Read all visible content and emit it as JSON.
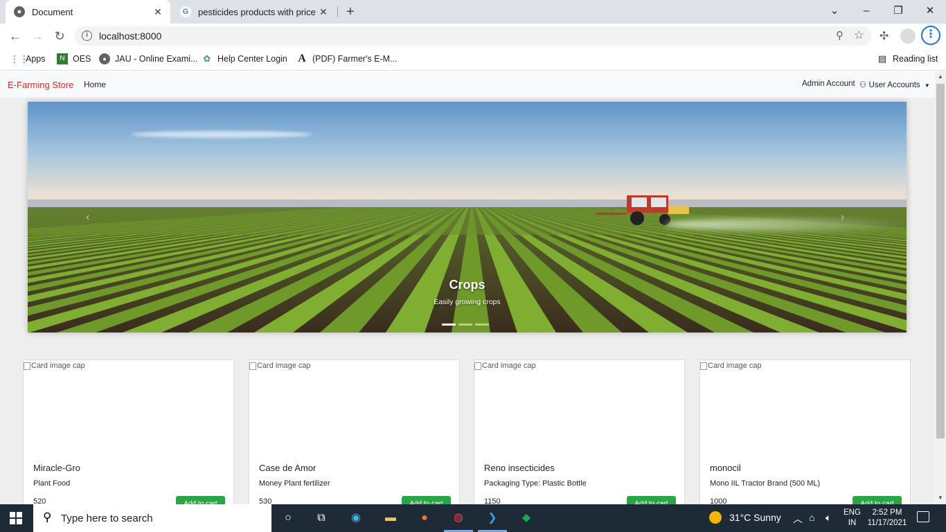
{
  "browser": {
    "tabs": [
      {
        "title": "Document",
        "favicon": "globe-icon",
        "active": true
      },
      {
        "title": "pesticides products with price - G",
        "favicon": "google-icon",
        "active": false
      }
    ],
    "url": "localhost:8000",
    "bookmarks": [
      {
        "label": "Apps",
        "icon": "apps-grid-icon"
      },
      {
        "label": "OES",
        "icon": "oes-icon"
      },
      {
        "label": "JAU - Online Exami...",
        "icon": "globe-icon"
      },
      {
        "label": "Help Center Login",
        "icon": "help-center-icon"
      },
      {
        "label": "(PDF) Farmer's E-M...",
        "icon": "academia-icon"
      }
    ],
    "reading_list": "Reading list"
  },
  "site": {
    "brand": "E-Farming Store",
    "home": "Home",
    "admin": "Admin Account",
    "users": "User Accounts"
  },
  "carousel": {
    "title": "Crops",
    "text": "Easily growing crops",
    "slides": 3,
    "active_slide": 1
  },
  "cards": [
    {
      "img_alt": "Card image cap",
      "name": "Miracle-Gro",
      "desc": "Plant Food",
      "price": "520",
      "button": "Add to cart"
    },
    {
      "img_alt": "Card image cap",
      "name": "Case de Amor",
      "desc": "Money Plant fertilizer",
      "price": "530",
      "button": "Add to cart"
    },
    {
      "img_alt": "Card image cap",
      "name": "Reno insecticides",
      "desc": "Packaging Type: Plastic Bottle",
      "price": "1150",
      "button": "Add to cart"
    },
    {
      "img_alt": "Card image cap",
      "name": "monocil",
      "desc": "Mono IIL Tractor Brand (500 ML)",
      "price": "1000",
      "button": "Add to cart"
    }
  ],
  "taskbar": {
    "search_placeholder": "Type here to search",
    "weather": "31°C  Sunny",
    "lang": "ENG",
    "region": "IN",
    "time": "2:52 PM",
    "date": "11/17/2021"
  },
  "colors": {
    "brand": "#d32f2f",
    "button": "#28a745",
    "taskbar": "#1f2a37"
  }
}
